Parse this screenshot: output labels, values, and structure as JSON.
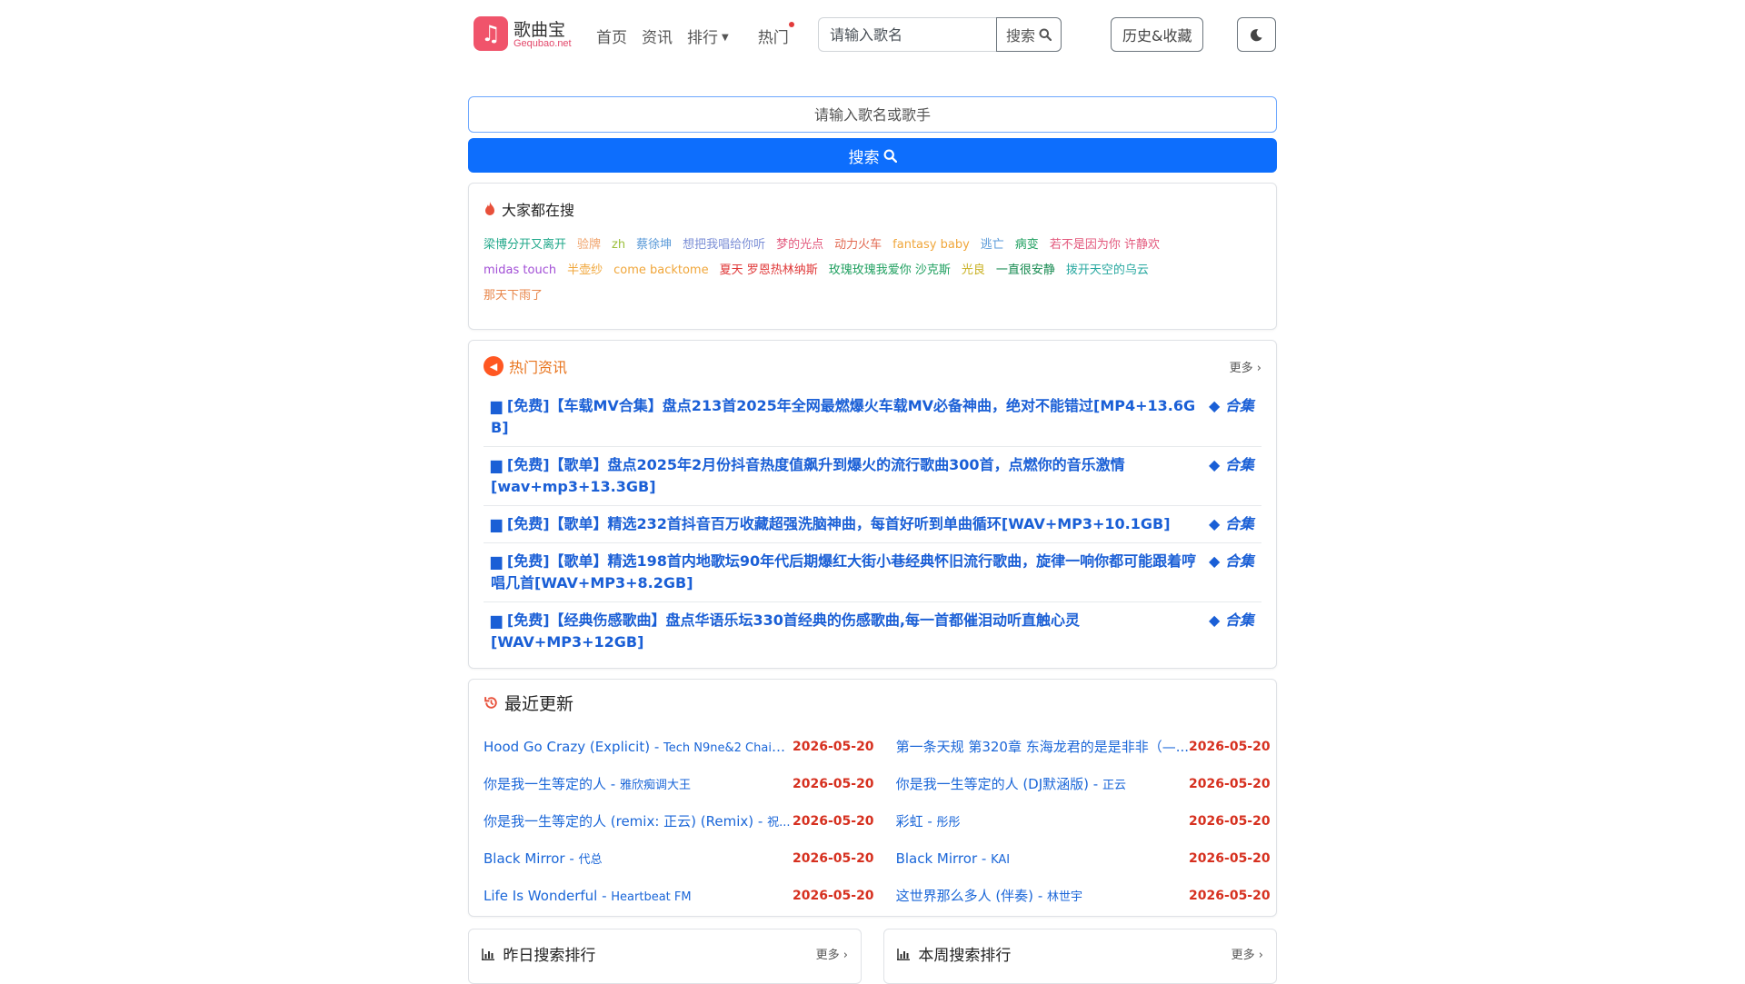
{
  "nav": {
    "logo_glyph": "♫",
    "brand": "歌曲宝",
    "brand_sub": "Gequbao.net",
    "links": [
      "首页",
      "资讯",
      "排行",
      "热门"
    ],
    "search_placeholder": "请输入歌名",
    "search_label": "搜索",
    "history_label": "历史&收藏"
  },
  "main_search": {
    "placeholder": "请输入歌名或歌手",
    "button_label": "搜索"
  },
  "hot_searches": {
    "title": "大家都在搜",
    "items": [
      {
        "text": "梁博分开又离开",
        "color": "#20a88a"
      },
      {
        "text": "验牌",
        "color": "#f0a36b"
      },
      {
        "text": "zh",
        "color": "#9bbf3a"
      },
      {
        "text": "蔡徐坤",
        "color": "#5a9ad8"
      },
      {
        "text": "想把我唱给你听",
        "color": "#7c8fd6"
      },
      {
        "text": "梦的光点",
        "color": "#e35a7e"
      },
      {
        "text": "动力火车",
        "color": "#e26a52"
      },
      {
        "text": "fantasy baby",
        "color": "#f0a63a"
      },
      {
        "text": "逃亡",
        "color": "#5a9ad8"
      },
      {
        "text": "病变",
        "color": "#20a060"
      },
      {
        "text": "若不是因为你 许静欢",
        "color": "#e35a7e"
      },
      {
        "text": "midas touch",
        "color": "#a24fd6"
      },
      {
        "text": "半壶纱",
        "color": "#f0a63a"
      },
      {
        "text": "come backtome",
        "color": "#f0a63a"
      },
      {
        "text": "夏天 罗恩热林纳斯",
        "color": "#e03a3a"
      },
      {
        "text": "玫瑰玫瑰我爱你 沙克斯",
        "color": "#20a060"
      },
      {
        "text": "光良",
        "color": "#c8b020"
      },
      {
        "text": "一直很安静",
        "color": "#168a50"
      },
      {
        "text": "拨开天空的乌云",
        "color": "#28a8a0"
      },
      {
        "text": "那天下雨了",
        "color": "#e8864a"
      }
    ]
  },
  "news": {
    "title": "热门资讯",
    "more": "更多",
    "items": [
      {
        "text": "[免费]【车载MV合集】盘点213首2025年全网最燃爆火车载MV必备神曲，绝对不能错过[MP4+13.6G B]",
        "tag": "合集"
      },
      {
        "text": "[免费]【歌单】盘点2025年2月份抖音热度值飙升到爆火的流行歌曲300首，点燃你的音乐激情[wav+mp3+13.3GB]",
        "tag": "合集"
      },
      {
        "text": "[免费]【歌单】精选232首抖音百万收藏超强洗脑神曲，每首好听到单曲循环[WAV+MP3+10.1GB]",
        "tag": "合集"
      },
      {
        "text": "[免费]【歌单】精选198首内地歌坛90年代后期爆红大街小巷经典怀旧流行歌曲，旋律一响你都可能跟着哼唱几首[WAV+MP3+8.2GB]",
        "tag": "合集"
      },
      {
        "text": "[免费]【经典伤感歌曲】盘点华语乐坛330首经典的伤感歌曲,每一首都催泪动听直触心灵[WAV+MP3+12GB]",
        "tag": "合集"
      }
    ]
  },
  "recent": {
    "title": "最近更新",
    "left": [
      {
        "song": "Hood Go Crazy (Explicit)",
        "artist": "Tech N9ne&2 Chainz...",
        "date": "2026-05-20"
      },
      {
        "song": "你是我一生等定的人",
        "artist": "雅欣痴调大王",
        "date": "2026-05-20"
      },
      {
        "song": "你是我一生等定的人 (remix: 正云) (Remix)",
        "artist": "祝...",
        "date": "2026-05-20"
      },
      {
        "song": "Black Mirror",
        "artist": "代总",
        "date": "2026-05-20"
      },
      {
        "song": "Life Is Wonderful",
        "artist": "Heartbeat FM",
        "date": "2026-05-20"
      }
    ],
    "right": [
      {
        "song": "第一条天规 第320章 东海龙君的是是非非（—...",
        "artist": "",
        "date": "2026-05-20"
      },
      {
        "song": "你是我一生等定的人 (DJ默涵版)",
        "artist": "正云",
        "date": "2026-05-20"
      },
      {
        "song": "彩虹",
        "artist": "彤彤",
        "date": "2026-05-20"
      },
      {
        "song": "Black Mirror",
        "artist": "KAI",
        "date": "2026-05-20"
      },
      {
        "song": "这世界那么多人 (伴奏)",
        "artist": "林世宇",
        "date": "2026-05-20"
      }
    ]
  },
  "rankings": [
    {
      "title": "昨日搜索排行",
      "more": "更多"
    },
    {
      "title": "本周搜索排行",
      "more": "更多"
    }
  ],
  "colors": {
    "primary": "#0d6efd",
    "link": "#1a66d8",
    "date": "#d6301f",
    "news_title": "#e8731c",
    "logo": "#f0546b"
  }
}
